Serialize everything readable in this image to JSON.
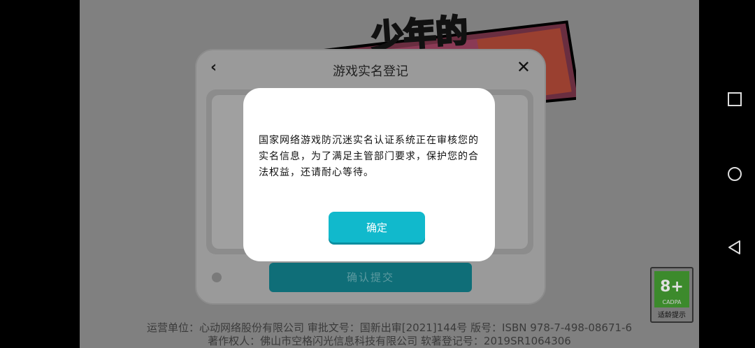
{
  "logo": {
    "text": "少年的"
  },
  "background_dialog": {
    "title": "游戏实名登记",
    "submit_label": "确认提交"
  },
  "modal": {
    "message": "国家网络游戏防沉迷实名认证系统正在审核您的实名信息，为了满足主管部门要求，保护您的合法权益，还请耐心等待。",
    "ok_label": "确定"
  },
  "footer": {
    "line1": "运营单位：心动网络股份有限公司 审批文号：国新出审[2021]144号 版号：ISBN 978-7-498-08671-6",
    "line2": "著作权人：佛山市空格闪光信息科技有限公司 软著登记号：2019SR1064306"
  },
  "age_rating": {
    "number": "8+",
    "org": "CADPA",
    "label": "适龄提示"
  },
  "colors": {
    "accent": "#11b9cc",
    "submit": "#0f6e78",
    "overlay": "#808080"
  }
}
